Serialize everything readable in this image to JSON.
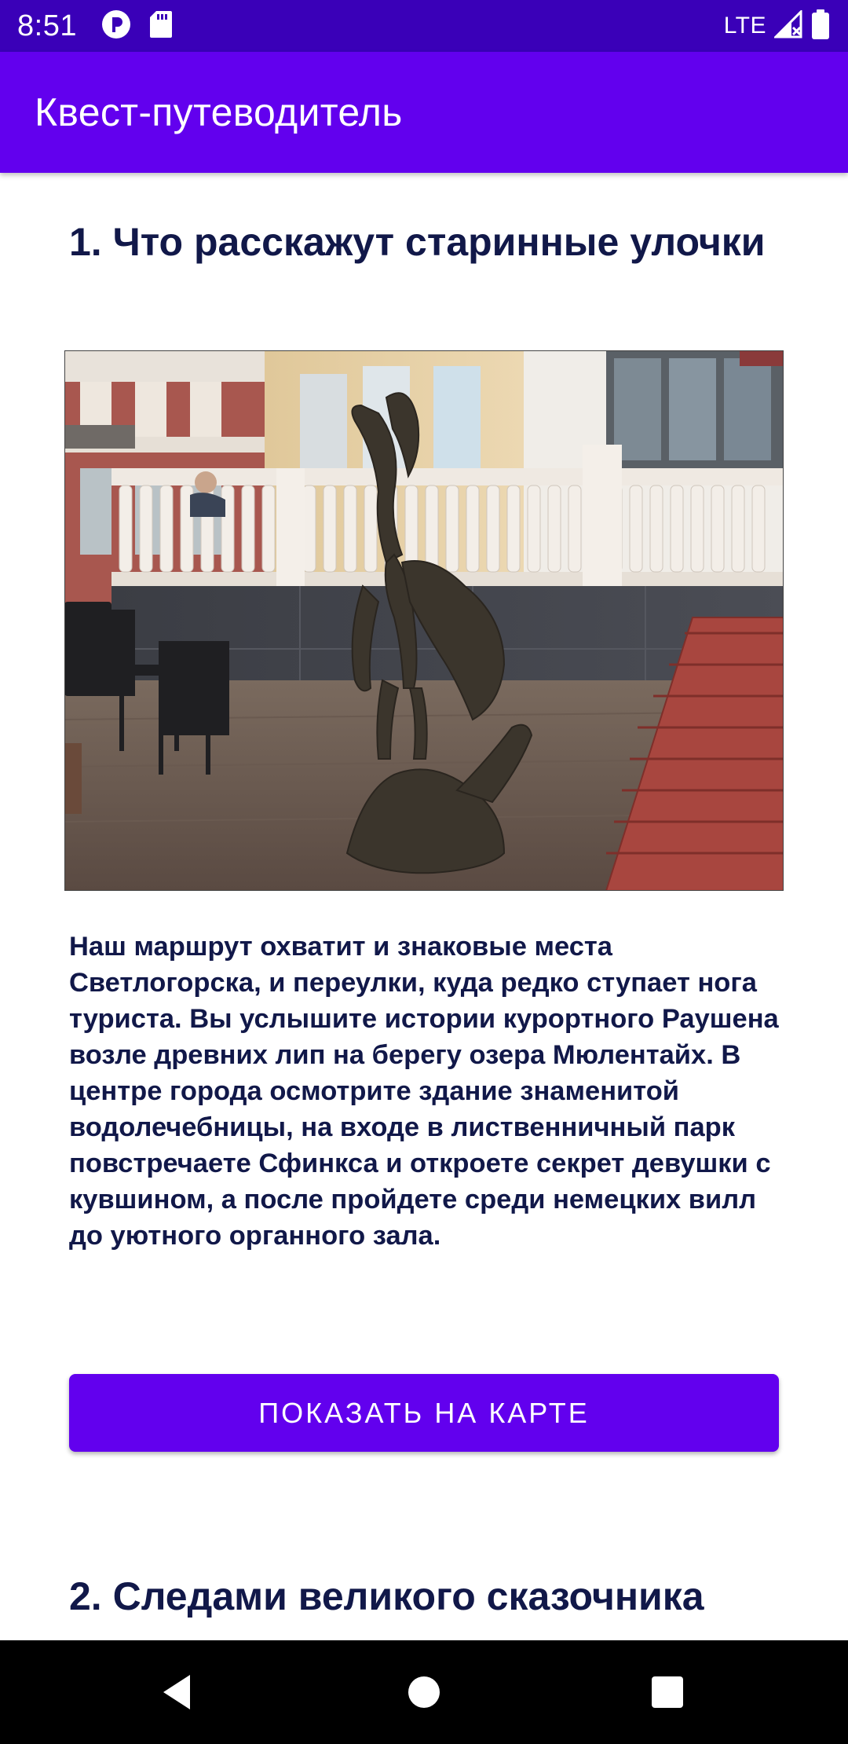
{
  "status_bar": {
    "time": "8:51",
    "network": "LTE",
    "icons": [
      "notification-p-icon",
      "sd-card-icon",
      "signal-icon",
      "battery-icon"
    ]
  },
  "app_bar": {
    "title": "Квест-путеводитель"
  },
  "sections": [
    {
      "title": "1. Что расскажут старинные улочки",
      "image": {
        "icon": "photo-statue-girl-with-jug"
      },
      "description": "Наш маршрут охватит и знаковые места Светлогорска, и переулки, куда редко ступает нога туриста. Вы услышите истории курортного Раушена возле древних лип на берегу озера Мюлентайх. В центре города осмотрите здание знаменитой водолечебницы, на входе в лиственничный парк повстречаете Сфинкса и откроете секрет девушки с кувшином, а после пройдете среди немецких вилл до уютного органного зала.",
      "button_label": "ПОКАЗАТЬ НА КАРТЕ"
    },
    {
      "title": "2. Следами великого сказочника"
    }
  ],
  "nav_bar": {
    "buttons": [
      "back-icon",
      "home-icon",
      "recents-icon"
    ]
  },
  "colors": {
    "status_bar": "#3a00b8",
    "primary": "#6200ee",
    "text": "#111849"
  }
}
